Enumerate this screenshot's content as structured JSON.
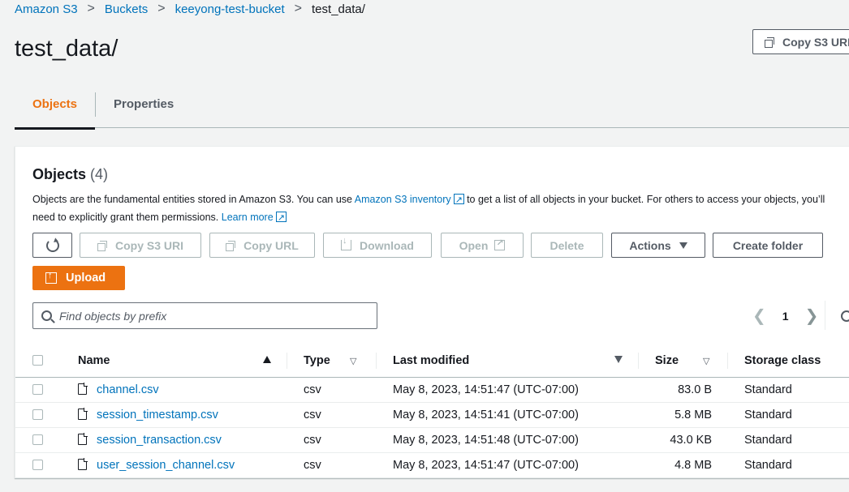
{
  "breadcrumb": {
    "items": [
      "Amazon S3",
      "Buckets",
      "keeyong-test-bucket"
    ],
    "current": "test_data/"
  },
  "page": {
    "title": "test_data/",
    "copy_s3_uri_label": "Copy S3 URI"
  },
  "tabs": [
    {
      "label": "Objects",
      "active": true
    },
    {
      "label": "Properties",
      "active": false
    }
  ],
  "objects_panel": {
    "heading": "Objects",
    "count": "(4)",
    "description_pre": "Objects are the fundamental entities stored in Amazon S3. You can use ",
    "inventory_link": "Amazon S3 inventory",
    "description_mid": " to get a list of all objects in your bucket. For others to access your objects, you’ll need to explicitly grant them permissions. ",
    "learn_more": "Learn more"
  },
  "toolbar": {
    "copy_s3_uri": "Copy S3 URI",
    "copy_url": "Copy URL",
    "download": "Download",
    "open": "Open",
    "delete": "Delete",
    "actions": "Actions",
    "create_folder": "Create folder",
    "upload": "Upload"
  },
  "search": {
    "placeholder": "Find objects by prefix"
  },
  "pagination": {
    "current_page": "1"
  },
  "table": {
    "columns": [
      "Name",
      "Type",
      "Last modified",
      "Size",
      "Storage class"
    ],
    "rows": [
      {
        "name": "channel.csv",
        "type": "csv",
        "modified": "May 8, 2023, 14:51:47 (UTC-07:00)",
        "size": "83.0 B",
        "storage": "Standard"
      },
      {
        "name": "session_timestamp.csv",
        "type": "csv",
        "modified": "May 8, 2023, 14:51:41 (UTC-07:00)",
        "size": "5.8 MB",
        "storage": "Standard"
      },
      {
        "name": "session_transaction.csv",
        "type": "csv",
        "modified": "May 8, 2023, 14:51:48 (UTC-07:00)",
        "size": "43.0 KB",
        "storage": "Standard"
      },
      {
        "name": "user_session_channel.csv",
        "type": "csv",
        "modified": "May 8, 2023, 14:51:47 (UTC-07:00)",
        "size": "4.8 MB",
        "storage": "Standard"
      }
    ]
  },
  "colors": {
    "link": "#0073bb",
    "accent": "#ec7211",
    "disabled": "#aab7b8"
  }
}
